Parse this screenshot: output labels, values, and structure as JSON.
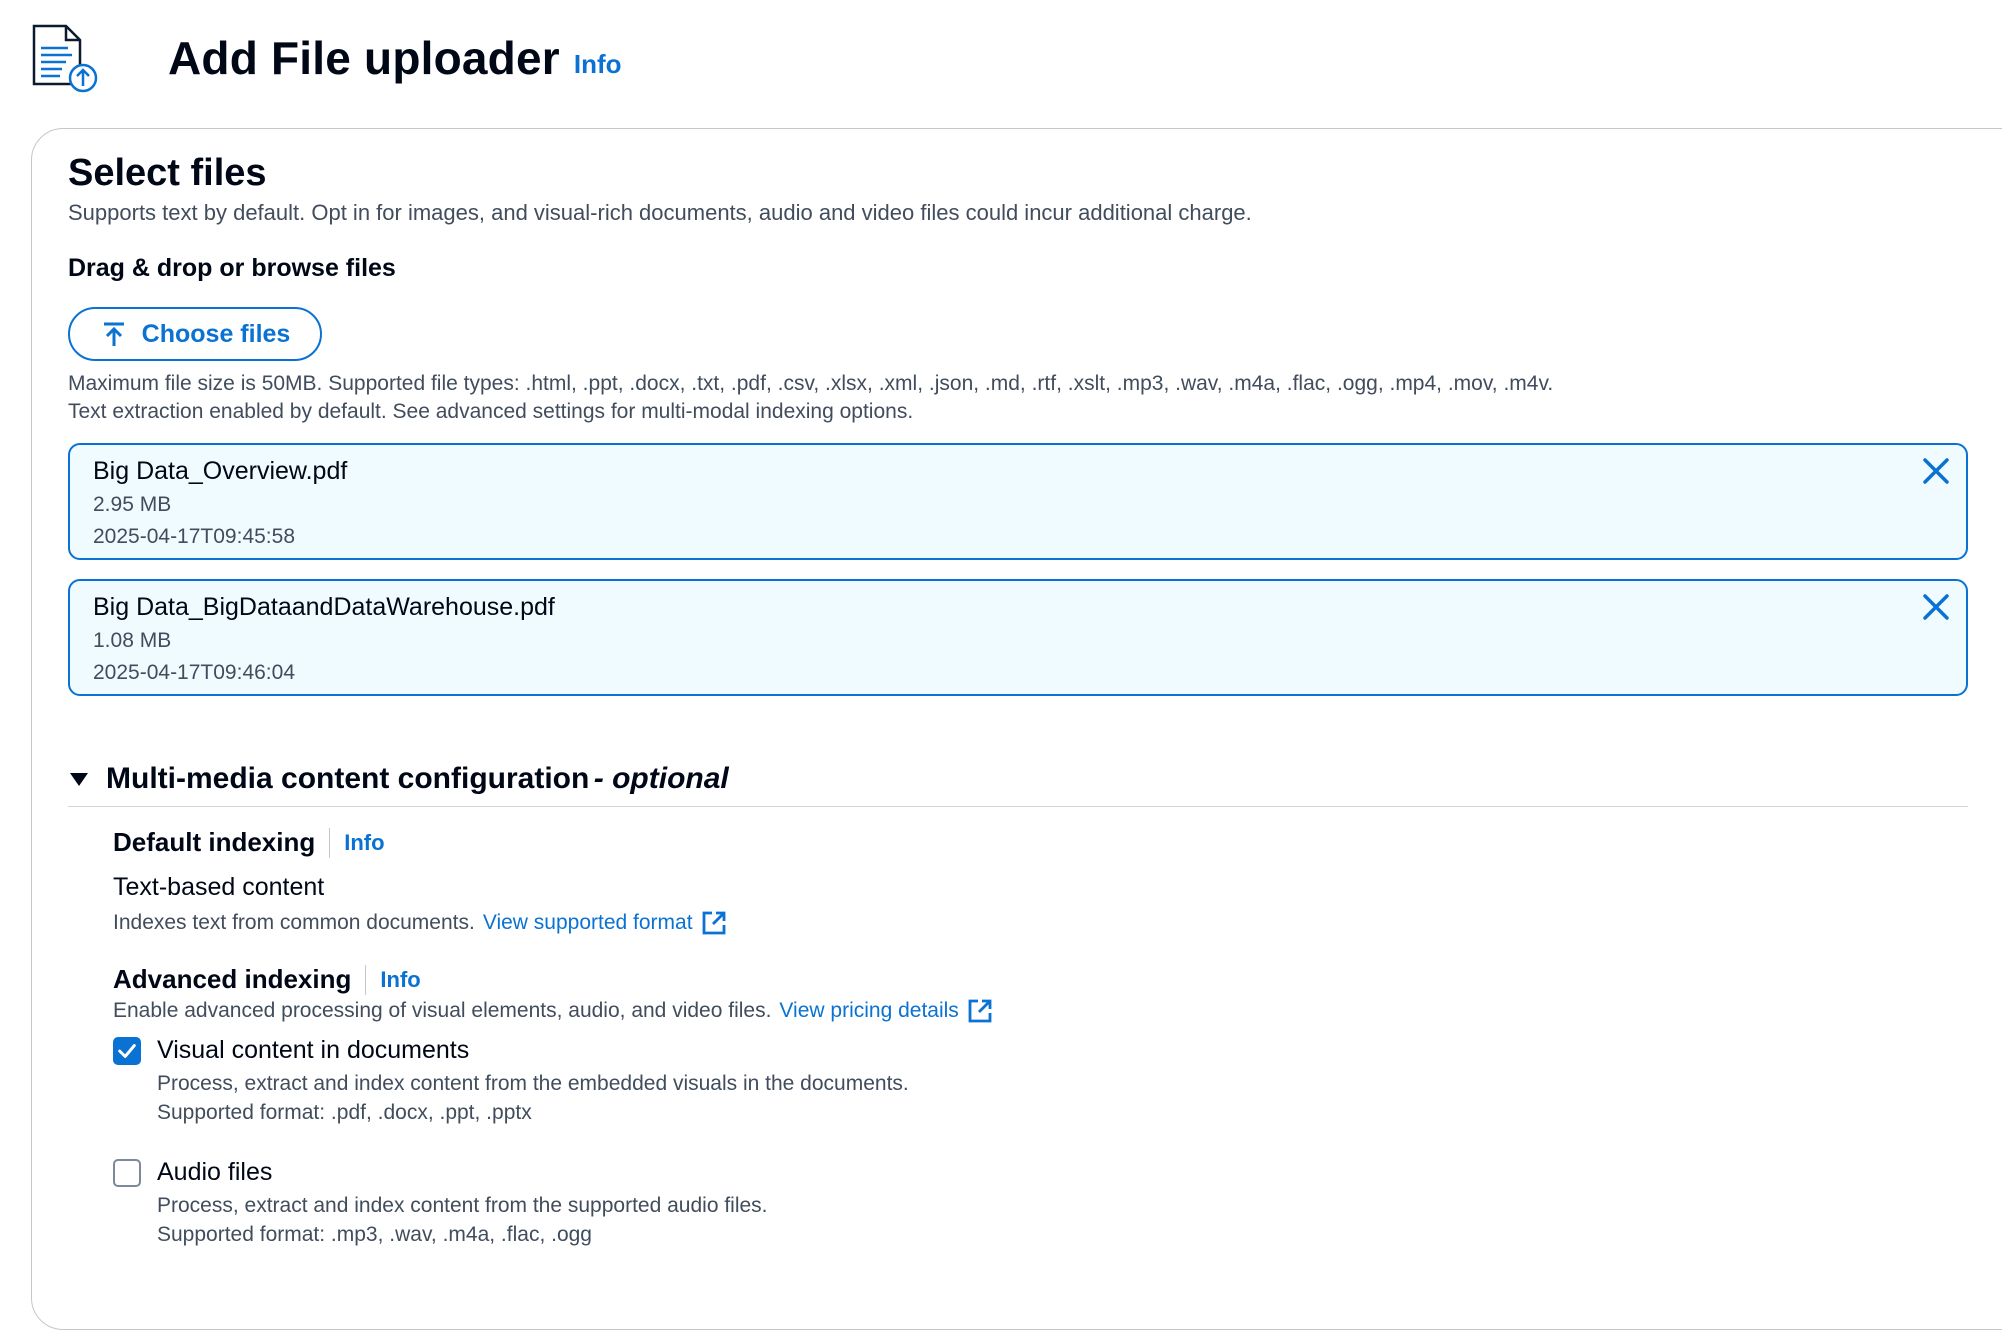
{
  "header": {
    "title": "Add File uploader",
    "info": "Info",
    "icon": "document-upload-icon"
  },
  "select_files": {
    "title": "Select files",
    "description": "Supports text by default. Opt in for images, and visual-rich documents, audio and video files could incur additional charge.",
    "drag_label": "Drag & drop or browse files",
    "choose_button": "Choose files",
    "constraint_1": "Maximum file size is 50MB. Supported file types: .html, .ppt, .docx, .txt, .pdf, .csv, .xlsx, .xml, .json, .md, .rtf, .xslt, .mp3, .wav, .m4a, .flac, .ogg, .mp4, .mov, .m4v.",
    "constraint_2": "Text extraction enabled by default. See advanced settings for multi-modal indexing options.",
    "files": [
      {
        "name": "Big Data_Overview.pdf",
        "size": "2.95 MB",
        "modified": "2025-04-17T09:45:58"
      },
      {
        "name": "Big Data_BigDataandDataWarehouse.pdf",
        "size": "1.08 MB",
        "modified": "2025-04-17T09:46:04"
      }
    ]
  },
  "multimedia": {
    "title": "Multi-media content configuration",
    "optional": "- optional",
    "expanded": true,
    "default_indexing": {
      "title": "Default indexing",
      "info": "Info",
      "content_label": "Text-based content",
      "description": "Indexes text from common documents.",
      "link": "View supported format"
    },
    "advanced_indexing": {
      "title": "Advanced indexing",
      "info": "Info",
      "description": "Enable advanced processing of visual elements, audio, and video files.",
      "link": "View pricing details",
      "options": [
        {
          "label": "Visual content in documents",
          "checked": true,
          "description": "Process, extract and index content from the embedded visuals in the documents.",
          "formats": "Supported format: .pdf, .docx, .ppt, .pptx"
        },
        {
          "label": "Audio files",
          "checked": false,
          "description": "Process, extract and index content from the supported audio files.",
          "formats": "Supported format: .mp3, .wav, .m4a, .flac, .ogg"
        }
      ]
    }
  },
  "colors": {
    "accent": "#0972d3",
    "token_bg": "#f0fbff",
    "text_primary": "#000716",
    "text_secondary": "#414d5c"
  }
}
